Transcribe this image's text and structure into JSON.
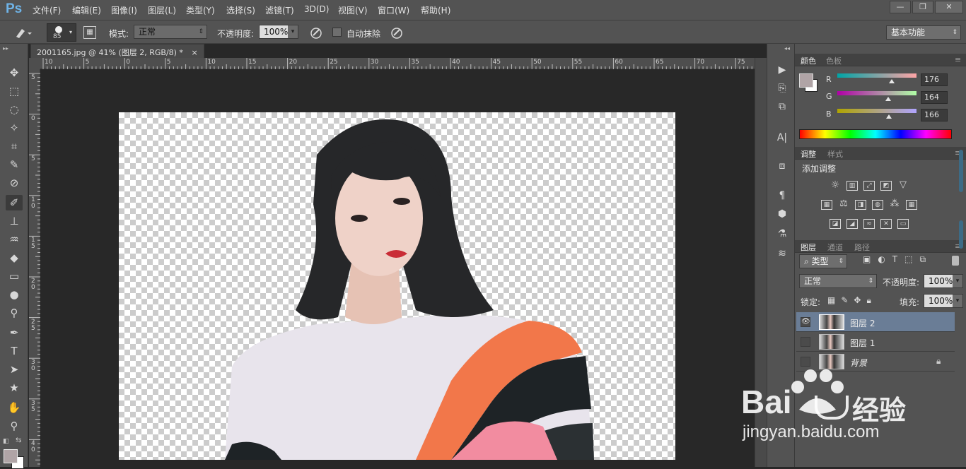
{
  "app": {
    "logo": "Ps"
  },
  "menu": [
    "文件(F)",
    "编辑(E)",
    "图像(I)",
    "图层(L)",
    "类型(Y)",
    "选择(S)",
    "滤镜(T)",
    "3D(D)",
    "视图(V)",
    "窗口(W)",
    "帮助(H)"
  ],
  "window_controls": {
    "minimize": "—",
    "restore": "❐",
    "close": "✕"
  },
  "options": {
    "brush_size": "85",
    "mode_label": "模式:",
    "mode_value": "正常",
    "opacity_label": "不透明度:",
    "opacity_value": "100%",
    "auto_erase_label": "自动抹除",
    "workspace": "基本功能"
  },
  "document": {
    "tab_title": "2001165.jpg @ 41% (图层 2, RGB/8) *",
    "tab_close": "×",
    "ruler_top_labels": [
      "10",
      "5",
      "0",
      "5",
      "10",
      "15",
      "20",
      "25",
      "30",
      "35",
      "40",
      "45",
      "50",
      "55",
      "60",
      "65",
      "70",
      "75"
    ],
    "ruler_left_labels": [
      "5",
      "0",
      "5",
      "1\n0",
      "1\n5",
      "2\n0",
      "2\n5",
      "3\n0",
      "3\n5",
      "4\n0"
    ]
  },
  "color_panel": {
    "tabs": [
      "颜色",
      "色板"
    ],
    "fg_color": "#b0a4a6",
    "channels": [
      {
        "name": "R",
        "value": "176",
        "pos": 0.69
      },
      {
        "name": "G",
        "value": "164",
        "pos": 0.64
      },
      {
        "name": "B",
        "value": "166",
        "pos": 0.65
      }
    ]
  },
  "adjust_panel": {
    "tabs": [
      "调整",
      "样式"
    ],
    "title": "添加调整"
  },
  "layers_panel": {
    "tabs": [
      "图层",
      "通道",
      "路径"
    ],
    "filter_type": "类型",
    "blend_mode": "正常",
    "opacity_label": "不透明度:",
    "opacity_value": "100%",
    "lock_label": "锁定:",
    "fill_label": "填充:",
    "fill_value": "100%",
    "layers": [
      {
        "name": "图层 2",
        "visible": true,
        "selected": true
      },
      {
        "name": "图层 1",
        "visible": false,
        "selected": false
      },
      {
        "name": "背景",
        "visible": false,
        "selected": false,
        "locked": true
      }
    ]
  },
  "watermark": {
    "brand_left": "Bai",
    "brand_right": "经验",
    "url": "jingyan.baidu.com"
  }
}
